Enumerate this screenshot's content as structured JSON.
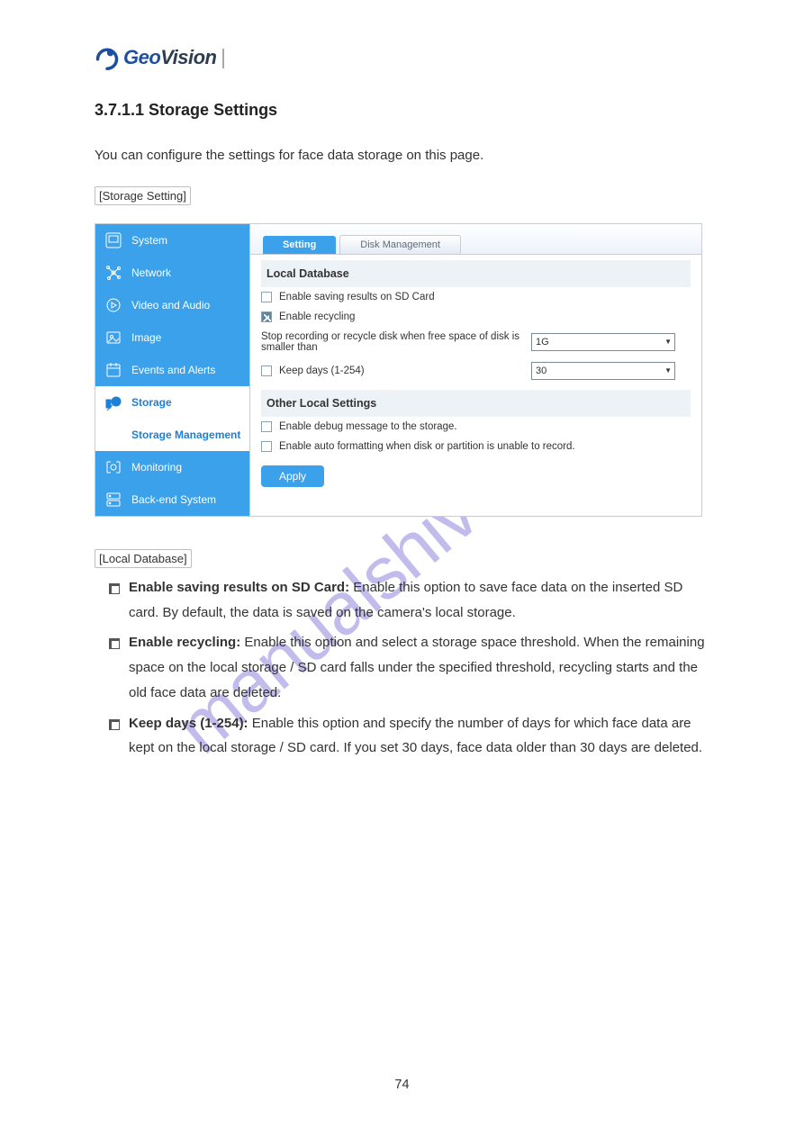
{
  "logo": {
    "brand_a": "Geo",
    "brand_b": "Vision"
  },
  "heading": "3.7.1.1  Storage Settings",
  "intro": "You can configure the settings for face data storage on this page.",
  "hint": "[Storage Setting]",
  "sidebar": {
    "items": [
      {
        "key": "system",
        "label": "System"
      },
      {
        "key": "network",
        "label": "Network"
      },
      {
        "key": "video",
        "label": "Video and Audio"
      },
      {
        "key": "image",
        "label": "Image"
      },
      {
        "key": "events",
        "label": "Events and Alerts"
      },
      {
        "key": "storage",
        "label": "Storage"
      },
      {
        "key": "monitor",
        "label": "Monitoring"
      },
      {
        "key": "backend",
        "label": "Back-end System"
      }
    ],
    "sub_label": "Storage Management"
  },
  "tabs": {
    "active": "Setting",
    "inactive": "Disk Management"
  },
  "panel": {
    "group1": "Local Database",
    "sd_card": {
      "label": "Enable saving results on SD Card",
      "checked": false
    },
    "recycle": {
      "label": "Enable recycling",
      "checked": true
    },
    "threshold": {
      "label": "Stop recording or recycle disk when free space of disk is smaller than",
      "value": "1G"
    },
    "keepdays": {
      "label": "Keep days (1-254)",
      "checked": false,
      "value": "30"
    },
    "group2": "Other Local Settings",
    "debug": {
      "label": "Enable debug message to the storage.",
      "checked": false
    },
    "autofmt": {
      "label": "Enable auto formatting when disk or partition is unable to record.",
      "checked": false
    },
    "apply": "Apply"
  },
  "bullets_head": "[Local Database]",
  "bullets": [
    {
      "b": "Enable saving results on SD Card:",
      "t": "Enable this option to save face data on the inserted SD card. By default, the data is saved on the camera's local storage."
    },
    {
      "b": "Enable recycling:",
      "t": "Enable this option and select a storage space threshold. When the remaining space on the local storage / SD card falls under the specified threshold, recycling starts and the old face data are deleted."
    },
    {
      "b": "Keep days (1-254):",
      "t": "Enable this option and specify the number of days for which face data are kept on the local storage / SD card. If you set 30 days, face data older than 30 days are deleted."
    }
  ],
  "page_no": "74"
}
